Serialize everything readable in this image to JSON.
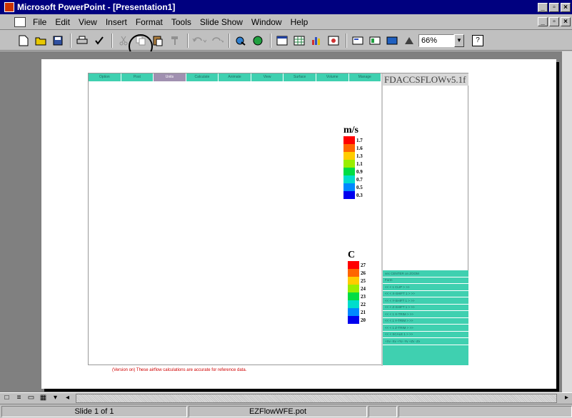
{
  "window": {
    "title": "Microsoft PowerPoint - [Presentation1]",
    "title_buttons": [
      "_",
      "▫",
      "×"
    ],
    "doc_buttons": [
      "_",
      "▫",
      "×"
    ]
  },
  "menu": {
    "items": [
      "File",
      "Edit",
      "View",
      "Insert",
      "Format",
      "Tools",
      "Slide Show",
      "Window",
      "Help"
    ]
  },
  "toolbar": {
    "zoom": "66%",
    "help": "?",
    "buttons": [
      "new-icon",
      "open-icon",
      "save-icon",
      "print-icon",
      "spelling-icon",
      "cut-icon",
      "copy-icon",
      "paste-icon",
      "format-painter-icon",
      "undo-icon",
      "redo-icon",
      "hyperlink-icon",
      "web-toolbar-icon",
      "insert-word-table-icon",
      "insert-excel-icon",
      "insert-chart-icon",
      "insert-clipart-icon",
      "new-slide-icon",
      "slide-layout-icon",
      "apply-design-icon",
      "grayscale-icon"
    ]
  },
  "embedded": {
    "tabs": [
      "Option",
      "Post",
      "Units",
      "Calculate",
      "Animate",
      "View",
      "Surface",
      "Volume",
      "Manage"
    ],
    "active_tab": 2,
    "header": "FDACCSFLOWv5.1f",
    "legend_velocity": {
      "unit": "m/s",
      "labels": [
        "1.7",
        "1.6",
        "1.3",
        "1.1",
        "0.9",
        "0.7",
        "0.5",
        "0.3"
      ],
      "colors": [
        "#ff0000",
        "#ff6600",
        "#ffcc00",
        "#99ee00",
        "#00dd44",
        "#00ddcc",
        "#0088ff",
        "#0000ee"
      ]
    },
    "legend_temperature": {
      "unit": "C",
      "labels": [
        "27",
        "26",
        "25",
        "24",
        "23",
        "22",
        "21",
        "20"
      ],
      "colors": [
        "#ff0000",
        "#ff6600",
        "#ffcc00",
        "#99ee00",
        "#00dd44",
        "#00ddcc",
        "#0088ff",
        "#0000ee"
      ]
    },
    "panel_rows": [
      "vec        CENTER  on  ZOOM",
      "Form",
      "<<  <        1  CLIP         >  >>",
      "<<  <    X-SHIFT  1          >  >>",
      "<<  <    Y-SHIFT  1          >  >>",
      "<<  <    Z-SHIFT  1          >  >>",
      "<<  <      1  X-TRIM       >  >>",
      "<<  <      1  Y-TRIM       >  >>",
      "<<  <      1  Z-TRIM       >  >>",
      "<<  <     SCALE  1          >  >>",
      "+Xv  -Xv  +Yv  -Yv  +Zv  -Zv"
    ],
    "footnote": "(Version on) These airflow calculations are accurate for reference data."
  },
  "status": {
    "slide": "Slide 1 of 1",
    "template": "EZFlowWFE.pot"
  }
}
